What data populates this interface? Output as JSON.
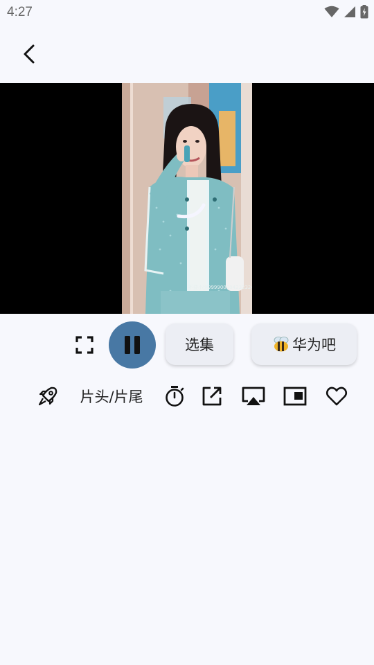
{
  "status": {
    "time": "4:27",
    "icons": [
      "wifi-icon",
      "cell-signal-icon",
      "battery-charging-icon"
    ]
  },
  "nav": {
    "back_icon": "back-arrow-icon"
  },
  "player": {
    "watermark": "不要小别9999000042323240"
  },
  "controls": {
    "fullscreen_icon": "fullscreen-icon",
    "pause_icon": "pause-icon",
    "episodes_label": "选集",
    "source_icon": "bee-icon",
    "source_label": "华为吧"
  },
  "tools": {
    "skip_icon": "rocket-icon",
    "intro_outro_label": "片头/片尾",
    "timer_icon": "timer-icon",
    "open_external_icon": "open-external-icon",
    "cast_icon": "airplay-icon",
    "pip_icon": "picture-in-picture-icon",
    "favorite_icon": "heart-icon"
  },
  "colors": {
    "background": "#f7f8fd",
    "accent": "#4878a4",
    "pill": "#eceef4"
  }
}
